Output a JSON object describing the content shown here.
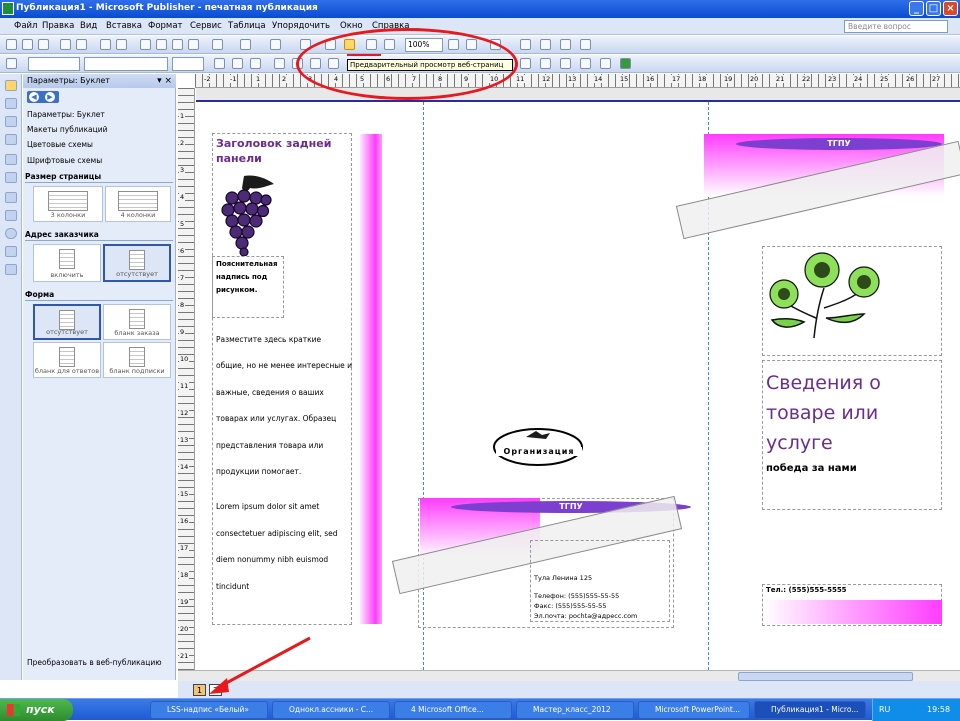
{
  "window": {
    "title": "Публикация1 - Microsoft Publisher - печатная публикация",
    "minimize": "_",
    "maximize": "□",
    "close": "×"
  },
  "menu": [
    "Файл",
    "Правка",
    "Вид",
    "Вставка",
    "Формат",
    "Сервис",
    "Таблица",
    "Упорядочить",
    "Окно",
    "Справка"
  ],
  "help_placeholder": "Введите вопрос",
  "toolbar": {
    "zoom": "100%",
    "tooltip": "Предварительный просмотр веб-страниц"
  },
  "taskpane": {
    "title": "Параметры: Буклет",
    "links": [
      "Параметры: Буклет",
      "Макеты публикаций",
      "Цветовые схемы",
      "Шрифтовые схемы"
    ],
    "sections": {
      "page_size": "Размер страницы",
      "customer_address": "Адрес заказчика",
      "form": "Форма"
    },
    "page_size_opts": [
      "3 колонки",
      "4 колонки"
    ],
    "address_opts": [
      "включить",
      "отсутствует"
    ],
    "form_opts": [
      "отсутствует",
      "бланк заказа",
      "бланк для ответов",
      "бланк подписки"
    ],
    "footer": "Преобразовать в веб-публикацию"
  },
  "doc": {
    "back_title": "Заголовок задней панели",
    "caption": "Пояснительная надпись под рисунком.",
    "body_lines": [
      "Разместите здесь краткие",
      "общие, но не менее интересные и",
      "важные, сведения о ваших",
      "товарах или услугах. Образец",
      "представления товара или",
      "продукции помогает.",
      "Lorem ipsum dolor sit amet",
      "consectetuer adipiscing elit, sed",
      "diem nonummy nibh euismod",
      "tincidunt"
    ],
    "org": "Организация",
    "pill": "ТГПУ",
    "address": [
      "Тула Ленина 125",
      "Телефон: (555)555-55-55",
      "Факс: (555)555-55-55",
      "Эл.почта: pochta@адресс.com"
    ],
    "product_title": "Сведения о товаре или услуге",
    "product_sub": "победа за нами",
    "phone": "Тел.: (555)555-5555"
  },
  "pages": [
    "1",
    "2"
  ],
  "rulers": {
    "h": [
      "-2",
      "-1",
      "1",
      "2",
      "3",
      "4",
      "5",
      "6",
      "7",
      "8",
      "9",
      "10",
      "11",
      "12",
      "13",
      "14",
      "15",
      "16",
      "17",
      "18",
      "19",
      "20",
      "21",
      "22",
      "23",
      "24",
      "25",
      "26",
      "27"
    ],
    "v": [
      "1",
      "2",
      "3",
      "4",
      "5",
      "6",
      "7",
      "8",
      "9",
      "10",
      "11",
      "12",
      "13",
      "14",
      "15",
      "16",
      "17",
      "18",
      "19",
      "20",
      "21"
    ]
  },
  "taskbar": {
    "start": "пуск",
    "buttons": [
      "LSS-надпис «Белый»",
      "Однокл.ассники - С...",
      "4 Microsoft Office...",
      "Мастер_класс_2012",
      "Microsoft PowerPoint...",
      "Публикация1 - Micro..."
    ],
    "lang": "RU",
    "time": "19:58"
  },
  "colors": {
    "accent": "#6a2c91",
    "magenta": "#ff3cff",
    "pill": "#7d3fcf",
    "annotation": "#e8181d"
  }
}
